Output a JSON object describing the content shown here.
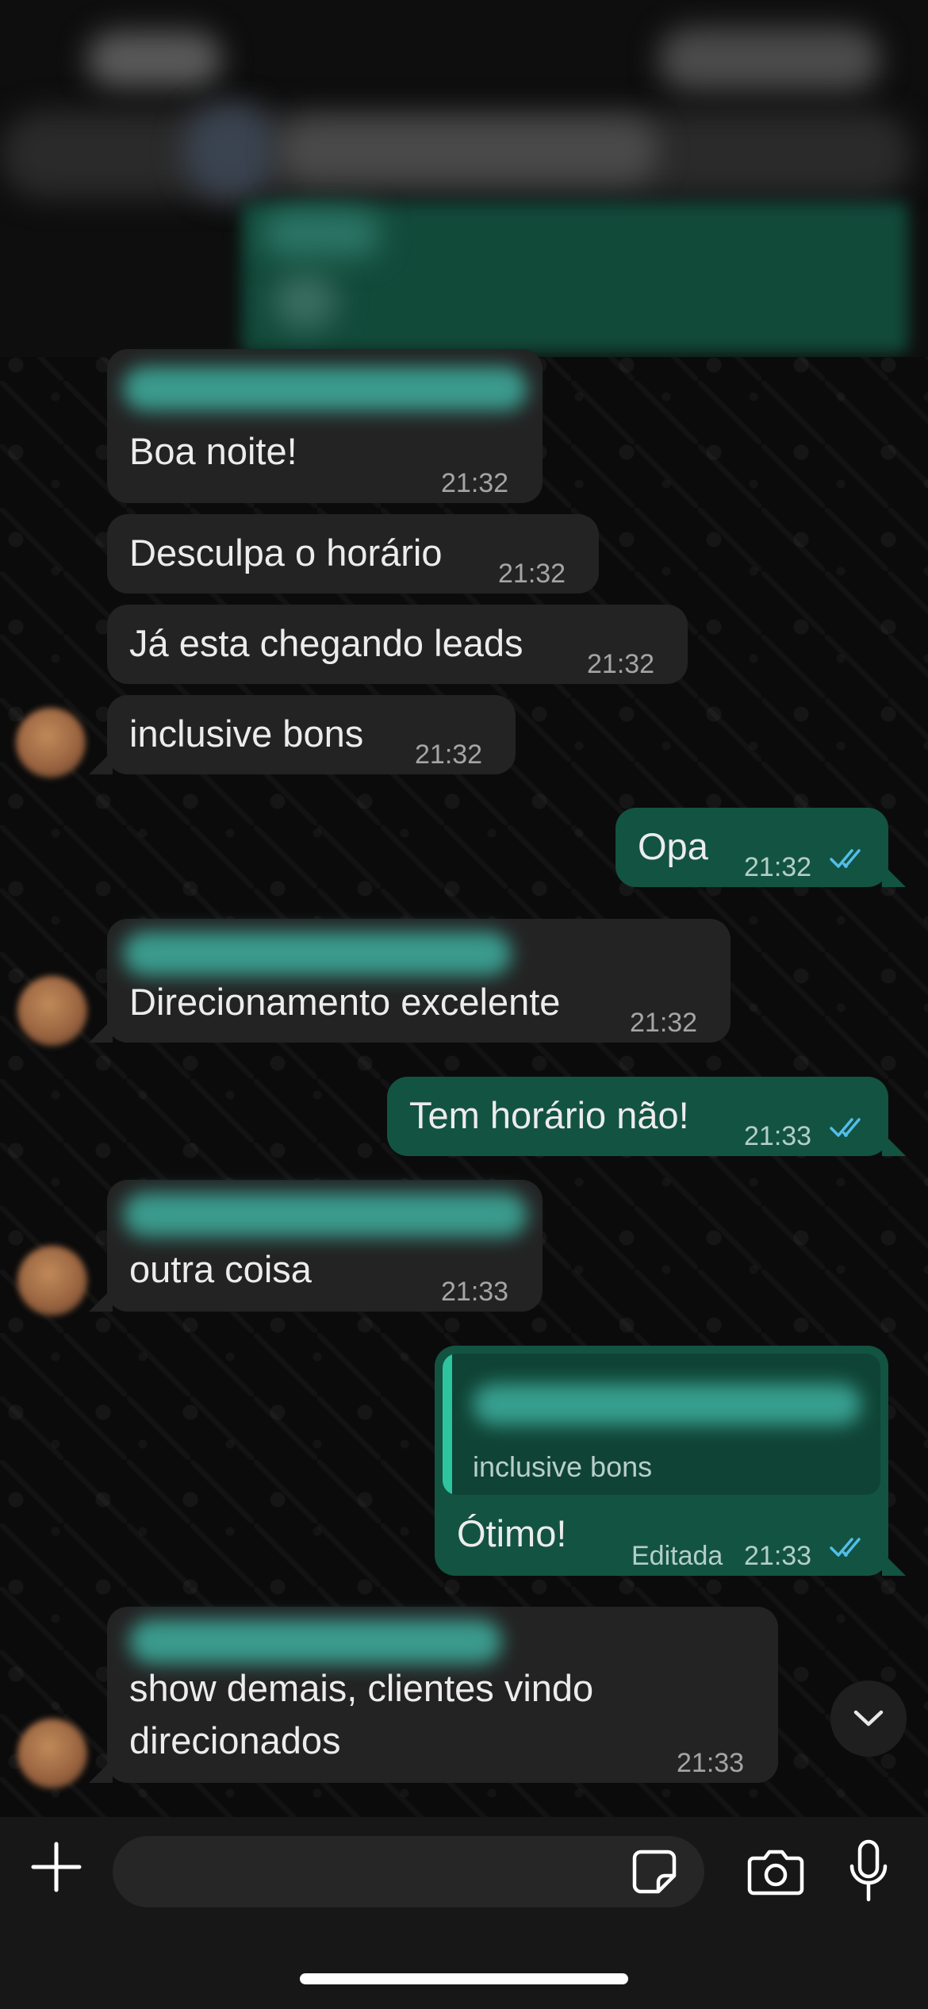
{
  "colors": {
    "incoming_bubble": "#232323",
    "outgoing_bubble": "#135341",
    "read_ticks": "#53bdeb",
    "background": "#0b0b0b"
  },
  "messages": [
    {
      "direction": "in",
      "text": "Boa noite!",
      "time": "21:32"
    },
    {
      "direction": "in",
      "text": "Desculpa o horário",
      "time": "21:32"
    },
    {
      "direction": "in",
      "text": "Já esta chegando leads",
      "time": "21:32"
    },
    {
      "direction": "in",
      "text": "inclusive bons",
      "time": "21:32"
    },
    {
      "direction": "out",
      "text": "Opa",
      "time": "21:32",
      "status": "read"
    },
    {
      "direction": "in",
      "text": "Direcionamento excelente",
      "time": "21:32"
    },
    {
      "direction": "out",
      "text": "Tem horário não!",
      "time": "21:33",
      "status": "read"
    },
    {
      "direction": "in",
      "text": "outra coisa",
      "time": "21:33"
    },
    {
      "direction": "out",
      "text": "Ótimo!",
      "time": "21:33",
      "edited_label": "Editada",
      "status": "read",
      "reply_quote": "inclusive bons"
    },
    {
      "direction": "in",
      "text_line1": "show demais, clientes vindo",
      "text_line2": "direcionados",
      "time": "21:33"
    }
  ],
  "icons": {
    "attach": "plus-icon",
    "sticker": "sticker-icon",
    "camera": "camera-icon",
    "mic": "microphone-icon",
    "scroll_down": "chevron-down-icon",
    "read_status": "double-check-icon"
  },
  "composer": {
    "value": ""
  }
}
